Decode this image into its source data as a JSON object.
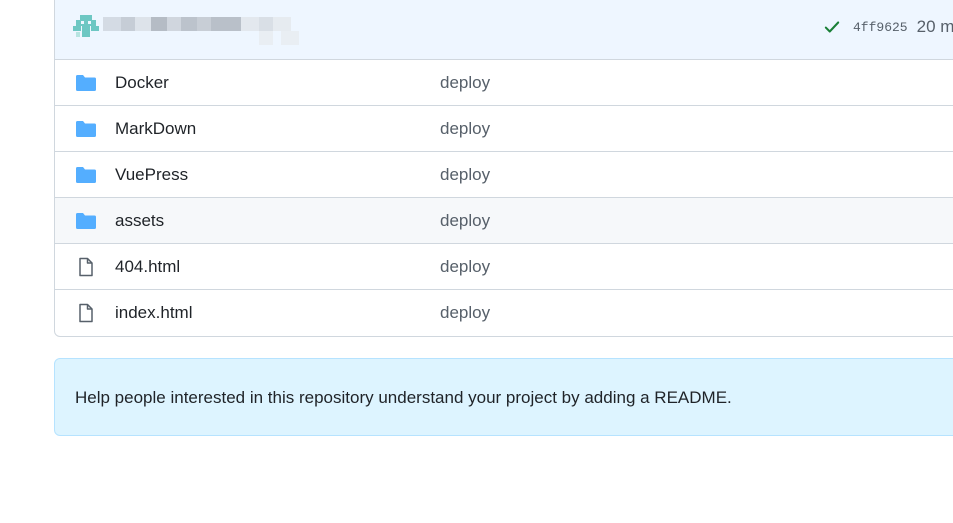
{
  "commit": {
    "sha": "4ff9625",
    "time": "20 m",
    "status_color": "#1a7f37"
  },
  "files": [
    {
      "name": "Docker",
      "message": "deploy",
      "icon": "folder-icon"
    },
    {
      "name": "MarkDown",
      "message": "deploy",
      "icon": "folder-icon"
    },
    {
      "name": "VuePress",
      "message": "deploy",
      "icon": "folder-icon"
    },
    {
      "name": "assets",
      "message": "deploy",
      "icon": "folder-icon"
    },
    {
      "name": "404.html",
      "message": "deploy",
      "icon": "file-icon"
    },
    {
      "name": "index.html",
      "message": "deploy",
      "icon": "file-icon"
    }
  ],
  "readme_prompt": {
    "text": "Help people interested in this repository understand your project by adding a README."
  },
  "colors": {
    "folder": "#54aeff",
    "header_bg": "#eef6ff",
    "readme_bg": "#ddf4ff"
  }
}
